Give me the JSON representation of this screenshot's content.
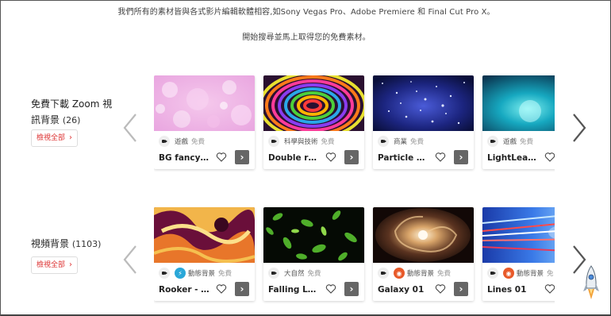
{
  "intro": {
    "line1": "我們所有的素材皆與各式影片編輯軟體相容,如Sony Vegas Pro、Adobe Premiere 和 Final Cut Pro X。",
    "line2": "開始搜尋並馬上取得您的免費素材。"
  },
  "sections": [
    {
      "title": "免費下載 Zoom 視訊背景",
      "count": "(26)",
      "view_all": "檢視全部",
      "cards": [
        {
          "category": "遊戲",
          "free": "免費",
          "name": "BG fancy…",
          "badge": "camera"
        },
        {
          "category": "科學與技術",
          "free": "免費",
          "name": "Double r…",
          "badge": "camera"
        },
        {
          "category": "商業",
          "free": "免費",
          "name": "Particle …",
          "badge": "camera"
        },
        {
          "category": "遊戲",
          "free": "免費",
          "name": "LightLea…",
          "badge": "camera"
        }
      ]
    },
    {
      "title": "視頻背景",
      "count": "(1103)",
      "view_all": "檢視全部",
      "cards": [
        {
          "category": "動態背景",
          "free": "免費",
          "name": "Rooker - …",
          "badge": "bolt"
        },
        {
          "category": "大自然",
          "free": "免費",
          "name": "Falling L…",
          "badge": "camera"
        },
        {
          "category": "動態背景",
          "free": "免費",
          "name": "Galaxy 01",
          "badge": "eye"
        },
        {
          "category": "動態背景",
          "free": "免",
          "name": "Lines 01",
          "badge": "eye"
        }
      ]
    }
  ],
  "colors": {
    "accent_red": "#d93a2b",
    "badge_blue": "#2aa7d8",
    "badge_orange": "#e85a2a"
  }
}
